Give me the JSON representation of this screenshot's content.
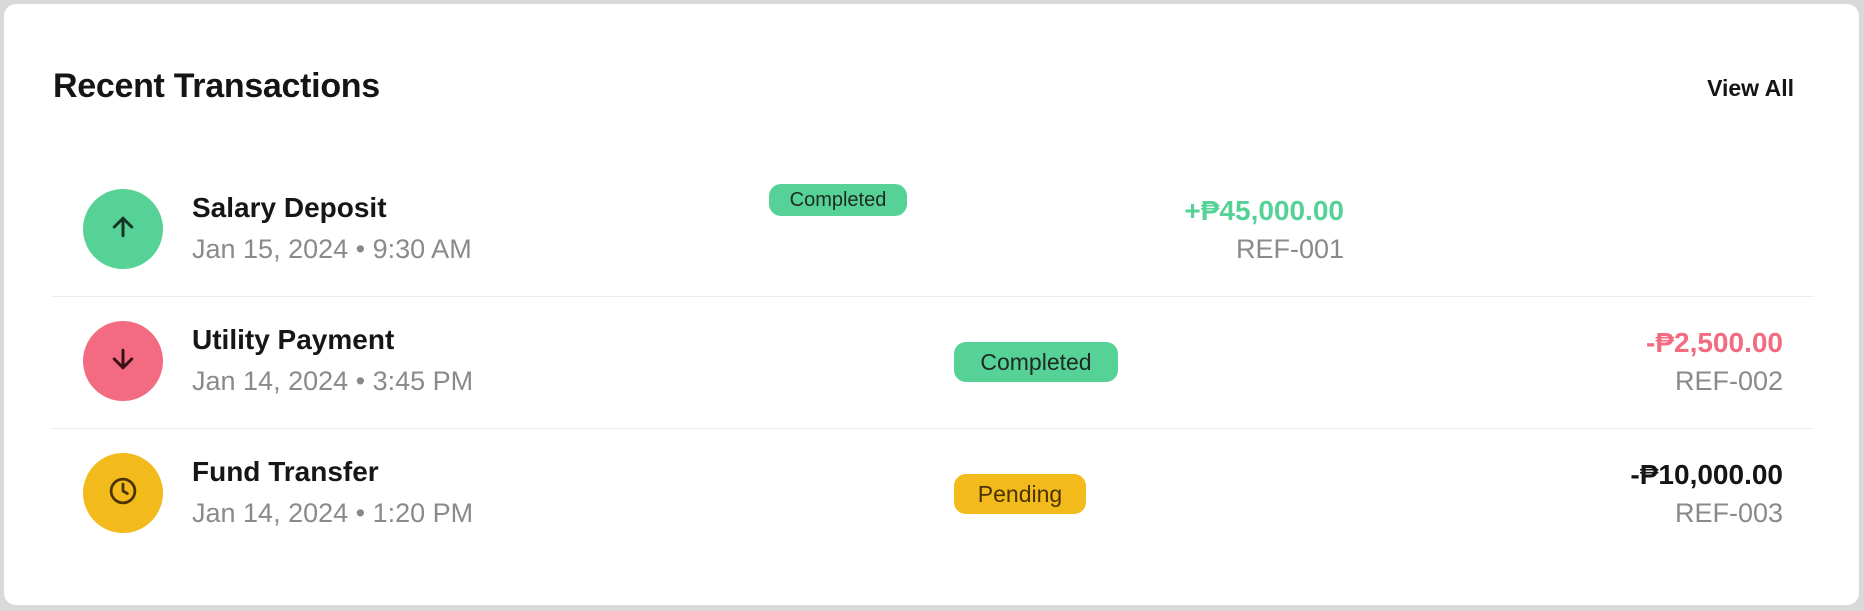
{
  "header": {
    "title": "Recent Transactions",
    "view_all_label": "View All"
  },
  "colors": {
    "income": "#57d296",
    "expense": "#f26b80",
    "pending": "#f2bb1b",
    "text_primary": "#151515",
    "text_muted": "#8a8a8a"
  },
  "transactions": [
    {
      "name": "Salary Deposit",
      "date": "Jan 15, 2024",
      "separator": "•",
      "time": "9:30 AM",
      "status": "Completed",
      "amount": "+₱45,000.00",
      "reference": "REF-001",
      "icon": "arrow-up-icon"
    },
    {
      "name": "Utility Payment",
      "date": "Jan 14, 2024",
      "separator": "•",
      "time": "3:45 PM",
      "status": "Completed",
      "amount": "-₱2,500.00",
      "reference": "REF-002",
      "icon": "arrow-down-icon"
    },
    {
      "name": "Fund Transfer",
      "date": "Jan 14, 2024",
      "separator": "•",
      "time": "1:20 PM",
      "status": "Pending",
      "amount": "-₱10,000.00",
      "reference": "REF-003",
      "icon": "clock-icon"
    }
  ]
}
